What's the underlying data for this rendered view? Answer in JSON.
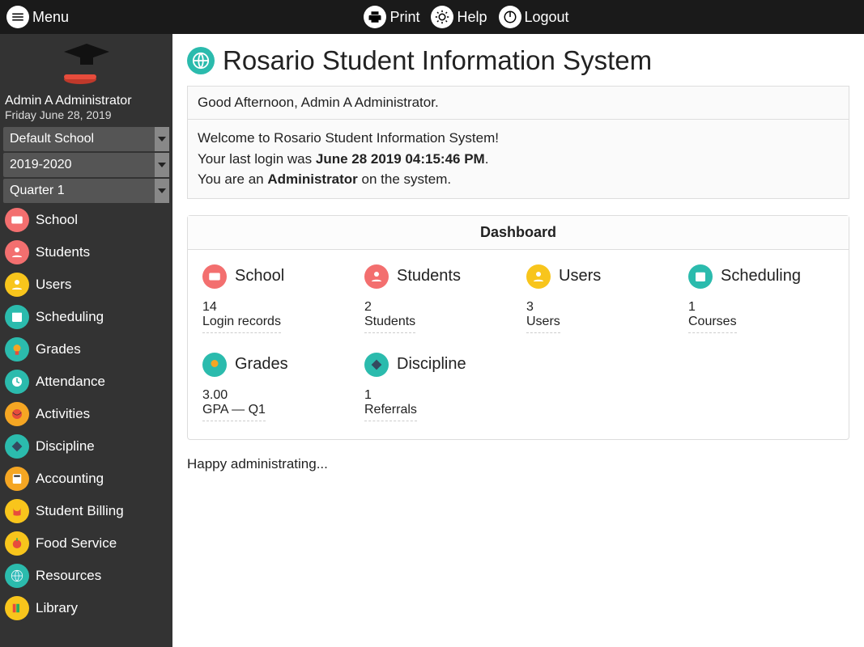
{
  "topbar": {
    "menu": "Menu",
    "print": "Print",
    "help": "Help",
    "logout": "Logout"
  },
  "user": {
    "name": "Admin A Administrator",
    "date": "Friday June 28, 2019"
  },
  "selectors": {
    "school": "Default School",
    "year": "2019-2020",
    "period": "Quarter 1"
  },
  "nav": {
    "school": "School",
    "students": "Students",
    "users": "Users",
    "scheduling": "Scheduling",
    "grades": "Grades",
    "attendance": "Attendance",
    "activities": "Activities",
    "discipline": "Discipline",
    "accounting": "Accounting",
    "student_billing": "Student Billing",
    "food_service": "Food Service",
    "resources": "Resources",
    "library": "Library"
  },
  "page": {
    "title": "Rosario Student Information System",
    "greeting": "Good Afternoon, Admin A Administrator.",
    "welcome_line": "Welcome to Rosario Student Information System!",
    "last_login_prefix": "Your last login was ",
    "last_login_value": "June 28 2019 04:15:46 PM",
    "role_prefix": "You are an ",
    "role_value": "Administrator",
    "role_suffix": " on the system.",
    "dashboard_title": "Dashboard",
    "footer": "Happy administrating..."
  },
  "dashboard": {
    "school": {
      "title": "School",
      "value": "14",
      "label": "Login records"
    },
    "students": {
      "title": "Students",
      "value": "2",
      "label": "Students"
    },
    "users": {
      "title": "Users",
      "value": "3",
      "label": "Users"
    },
    "scheduling": {
      "title": "Scheduling",
      "value": "1",
      "label": "Courses"
    },
    "grades": {
      "title": "Grades",
      "value": "3.00",
      "label": "GPA — Q1"
    },
    "discipline": {
      "title": "Discipline",
      "value": "1",
      "label": "Referrals"
    }
  },
  "colors": {
    "teal": "#2bbbad",
    "pink": "#f36f6f",
    "orange": "#f5a623",
    "yellow": "#f8c51c",
    "red": "#e74c3c"
  }
}
